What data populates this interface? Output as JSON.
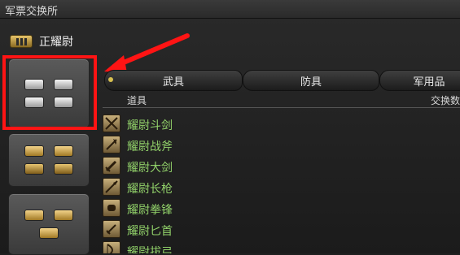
{
  "window": {
    "title": "军票交换所"
  },
  "rank": {
    "name": "正耀尉",
    "icon": "rank-insignia-icon"
  },
  "rank_buttons": [
    {
      "id": "rank-level-1",
      "chips": [
        "silver",
        "silver",
        "silver",
        "silver"
      ],
      "selected": true
    },
    {
      "id": "rank-level-2",
      "chips": [
        "gold",
        "gold",
        "gold2",
        "gold2"
      ]
    },
    {
      "id": "rank-level-3",
      "chips": [
        "gold",
        "gold",
        "gold"
      ]
    }
  ],
  "tabs": [
    {
      "label": "武具",
      "active": true
    },
    {
      "label": "防具"
    },
    {
      "label": "军用品"
    }
  ],
  "columns": {
    "item": "道具",
    "exchange": "交换数"
  },
  "items": [
    {
      "name": "耀尉斗剑",
      "icon": "crossed-swords-icon"
    },
    {
      "name": "耀尉战斧",
      "icon": "battle-axe-icon"
    },
    {
      "name": "耀尉大剑",
      "icon": "greatsword-icon"
    },
    {
      "name": "耀尉长枪",
      "icon": "lance-icon"
    },
    {
      "name": "耀尉拳锋",
      "icon": "knuckles-icon"
    },
    {
      "name": "耀尉匕首",
      "icon": "dagger-icon"
    },
    {
      "name": "耀尉拔弓",
      "icon": "bow-icon"
    }
  ],
  "colors": {
    "highlight": "#ff1414",
    "item_name": "#92d26a"
  }
}
